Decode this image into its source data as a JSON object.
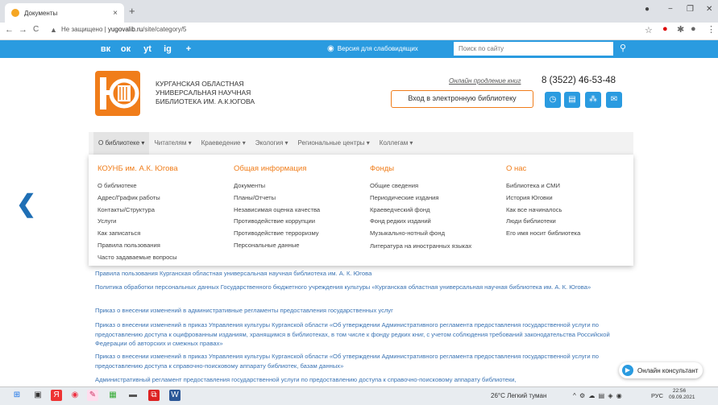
{
  "browser": {
    "tab_title": "Документы",
    "tab_close": "×",
    "new_tab": "+",
    "controls": {
      "min": "−",
      "max": "❐",
      "close": "✕"
    },
    "nav": {
      "back": "←",
      "forward": "→",
      "reload": "C"
    },
    "security_label": "Не защищено",
    "separator": "|",
    "url_host": "yugovalib.ru",
    "url_path": "/site/category/5",
    "star": "☆"
  },
  "site": {
    "social": [
      "вк",
      "ок",
      "yt",
      "ig",
      "+"
    ],
    "vision_link": "Версия для слабовидящих",
    "search_placeholder": "Поиск по сайту",
    "logo_lines": [
      "КУРГАНСКАЯ ОБЛАСТНАЯ",
      "УНИВЕРСАЛЬНАЯ НАУЧНАЯ",
      "БИБЛИОТЕКА ИМ. А.К.ЮГОВА"
    ],
    "renew_link": "Онлайн продление книг",
    "phone": "8 (3522) 46-53-48",
    "ebook_button": "Вход в электронную библиотеку",
    "menu": [
      "О библиотеке ▾",
      "Читателям ▾",
      "Краеведение ▾",
      "Экология ▾",
      "Региональные центры ▾",
      "Коллегам ▾"
    ],
    "dropdown": [
      {
        "heading": "КОУНБ им. А.К. Югова",
        "items": [
          "О библиотеке",
          "Адрес/График работы",
          "Контакты/Структура",
          "Услуги",
          "Как записаться",
          "Правила пользования",
          "Часто задаваемые вопросы"
        ]
      },
      {
        "heading": "Общая информация",
        "items": [
          "Документы",
          "Планы/Отчеты",
          "Независимая оценка качества",
          "Противодействие коррупции",
          "Противодействие терроризму",
          "Персональные данные"
        ]
      },
      {
        "heading": "Фонды",
        "items": [
          "Общие сведения",
          "Периодические издания",
          "Краеведческий фонд",
          "Фонд редких изданий",
          "Музыкально-нотный фонд",
          "Литература на иностранных языках"
        ]
      },
      {
        "heading": "О нас",
        "items": [
          "Библиотека и СМИ",
          "История Юговки",
          "Как все начиналось",
          "Люди библиотеки",
          "Его имя носит библиотека"
        ]
      }
    ],
    "prev_arrow": "❮",
    "documents": [
      "Правила пользования Курганская областная универсальная научная библиотека им. А. К. Югова",
      "Политика обработки персональных данных Государственного бюджетного учреждения культуры «Курганская областная универсальная научная библиотека им. А. К. Югова»",
      "Приказ о внесении изменений в административные регламенты предоставления государственных услуг",
      "Приказ о внесении изменений в приказ Управления культуры Курганской области «Об утверждении Административного регламента предоставления государственной услуги по предоставлению доступа к оцифрованным изданиям, хранящимся в библиотеках, в том числе к фонду редких книг, с учетом соблюдения требований законодательства Российской Федерации об авторских и смежных правах»",
      "Приказ о внесении изменений в приказ Управления культуры Курганской области «Об утверждении Административного регламента предоставления государственной услуги по предоставлению доступа к справочно-поисковому аппарату библиотек, базам данных»",
      "Административный регламент предоставления государственной услуги по предоставлению доступа к справочно-поисковому аппарату библиотеки,"
    ],
    "consultant": "Онлайн консультант"
  },
  "taskbar": {
    "weather": "26°C Легкий туман",
    "tray": "^ ⚙ ☁ ▤ ◈ ◉",
    "lang": "РУС",
    "time": "22:56",
    "date": "09.09.2021"
  },
  "colors": {
    "accent": "#2a9be0",
    "brand": "#f07d1a",
    "link": "#3a73b3"
  }
}
